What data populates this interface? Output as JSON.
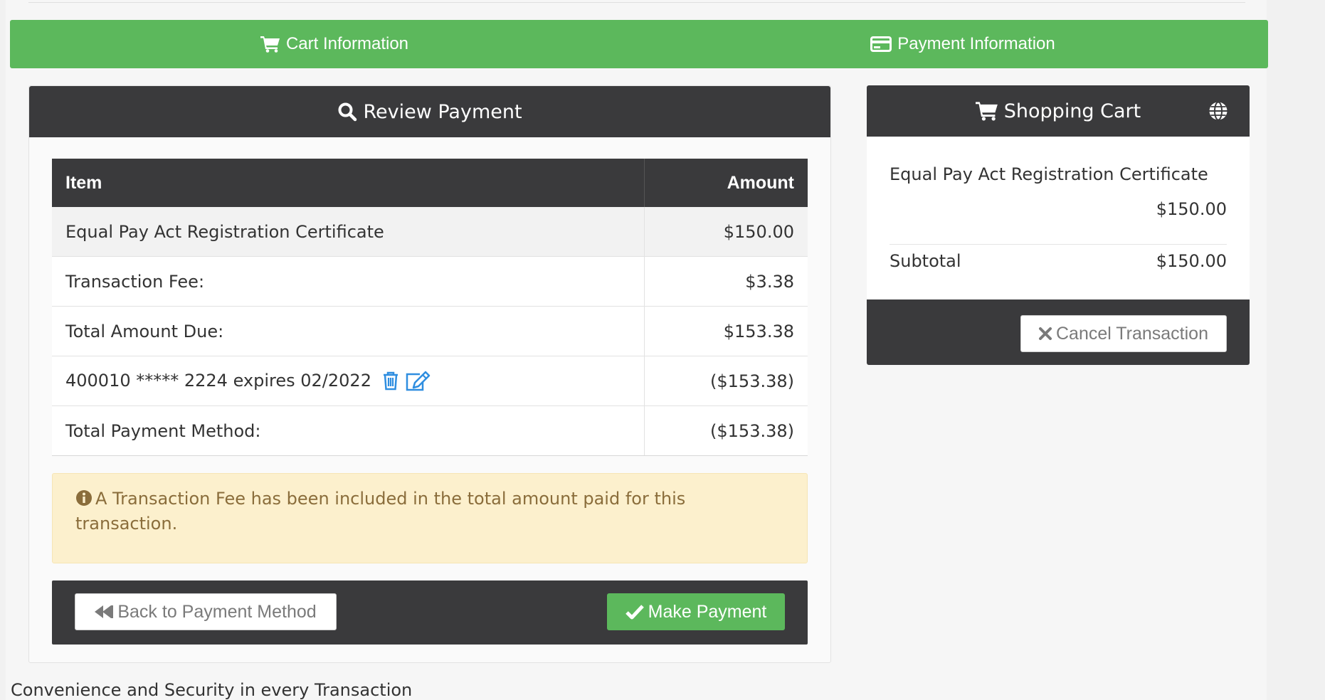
{
  "steps": {
    "cart_label": "Cart Information",
    "payment_label": "Payment Information"
  },
  "review": {
    "title": "Review Payment",
    "table": {
      "headers": [
        "Item",
        "Amount"
      ],
      "rows": [
        {
          "label": "Equal Pay Act Registration Certificate",
          "amount": "$150.00"
        },
        {
          "label": "Transaction Fee:",
          "amount": "$3.38"
        },
        {
          "label": "Total Amount Due:",
          "amount": "$153.38"
        },
        {
          "label": "400010 ***** 2224 expires 02/2022",
          "amount": "($153.38)"
        },
        {
          "label": "Total Payment Method:",
          "amount": "($153.38)"
        }
      ]
    },
    "alert": "A Transaction Fee has been included in the total amount paid for this transaction.",
    "back_label": "Back to Payment Method",
    "pay_label": "Make Payment"
  },
  "cart": {
    "title": "Shopping Cart",
    "item_name": "Equal Pay Act Registration Certificate",
    "item_amount": "$150.00",
    "subtotal_label": "Subtotal",
    "subtotal_amount": "$150.00",
    "cancel_label": "Cancel Transaction"
  },
  "footer": {
    "tagline": "Convenience and Security in every Transaction"
  },
  "colors": {
    "accent_green": "#5cb85c",
    "panel_dark": "#3a3a3c",
    "alert_bg": "#fcf0cd",
    "alert_text": "#8a6d3b",
    "link_blue": "#2f8ee0"
  },
  "icons": {
    "cart": "cart-icon",
    "card": "credit-card-icon",
    "review": "search-icon",
    "globe": "globe-icon",
    "trash": "trash-icon",
    "edit": "edit-icon",
    "info": "info-icon",
    "back": "backward-icon",
    "check": "check-icon",
    "cancel": "close-icon"
  }
}
